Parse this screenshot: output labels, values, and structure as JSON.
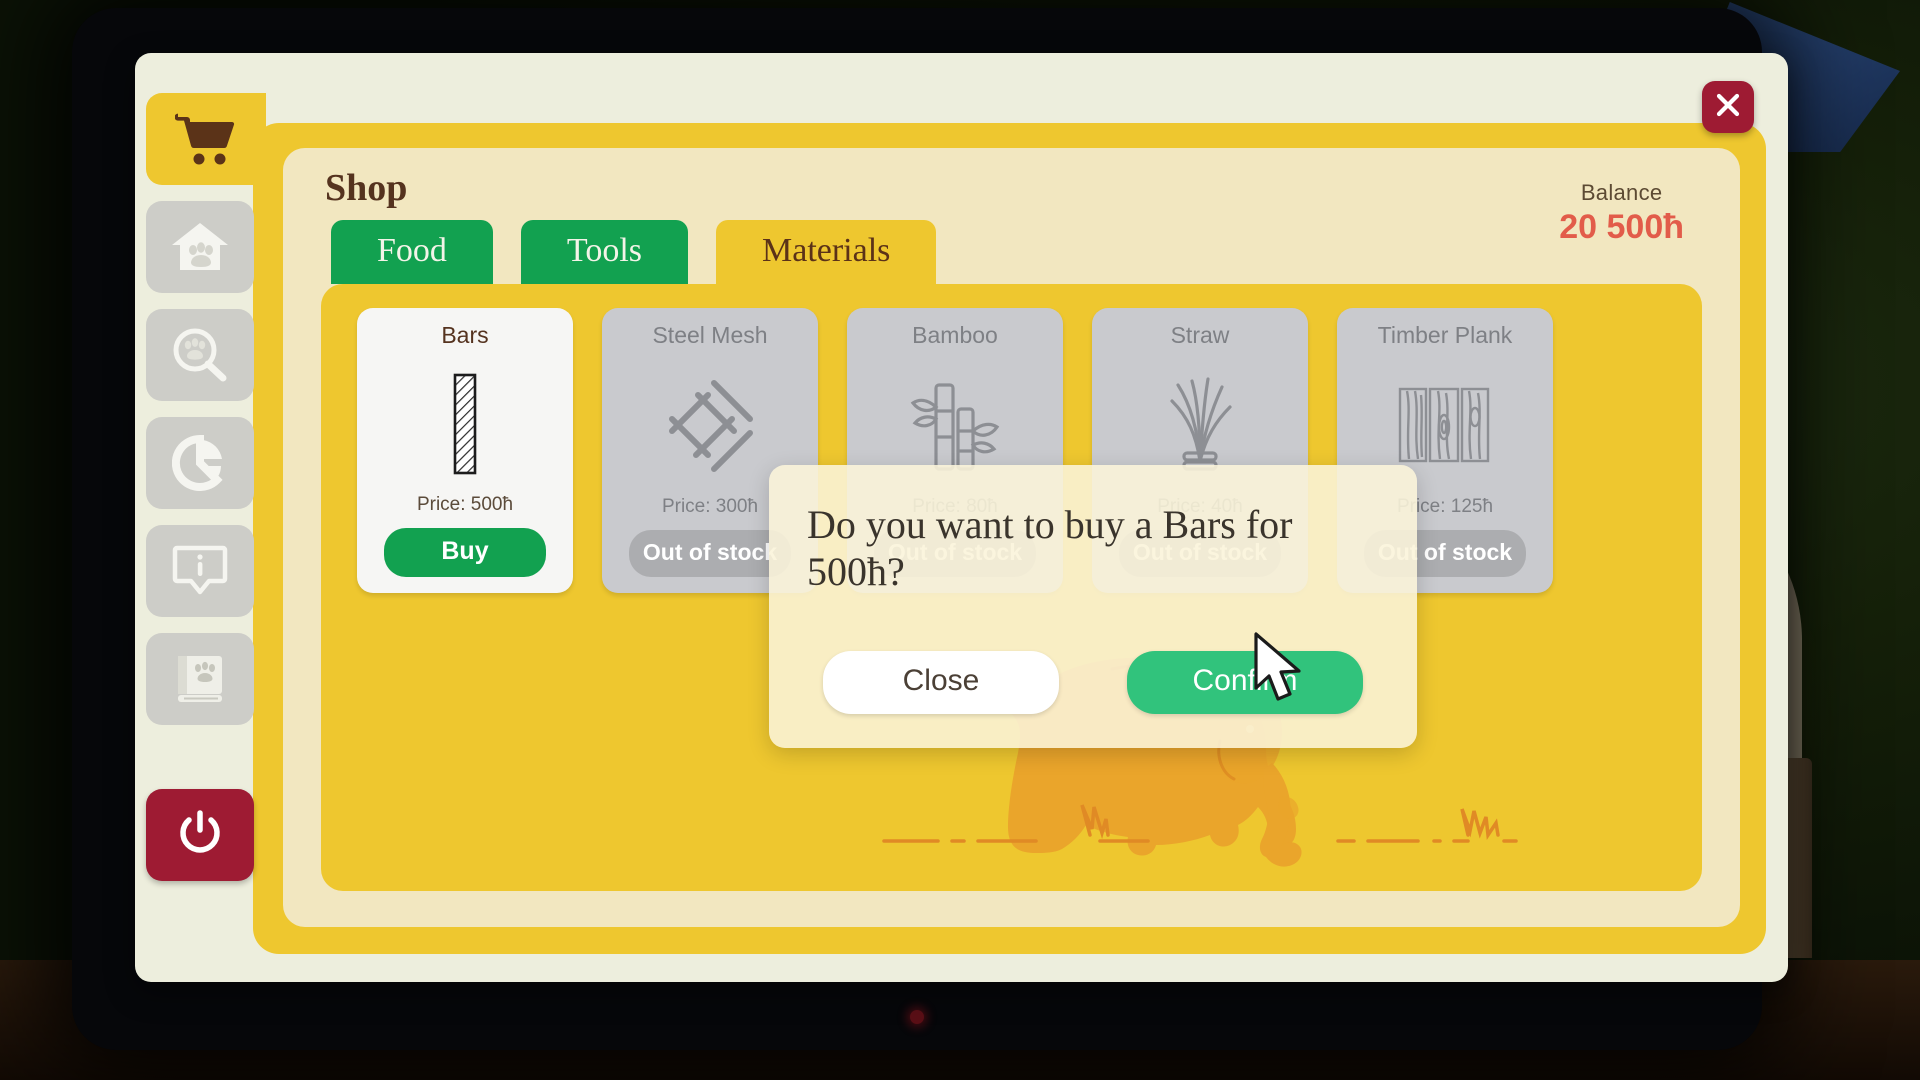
{
  "window": {
    "title": "Shop"
  },
  "sidebar": {
    "items": [
      {
        "icon": "shopping-cart-icon",
        "name": "shop",
        "active": true
      },
      {
        "icon": "pet-house-icon",
        "name": "habitats",
        "active": false
      },
      {
        "icon": "paw-search-icon",
        "name": "animal-search",
        "active": false
      },
      {
        "icon": "pie-chart-icon",
        "name": "statistics",
        "active": false
      },
      {
        "icon": "info-tooltip-icon",
        "name": "info",
        "active": false
      },
      {
        "icon": "paw-book-icon",
        "name": "encyclopedia",
        "active": false
      }
    ],
    "power": {
      "icon": "power-icon",
      "name": "quit"
    }
  },
  "header": {
    "title": "Shop",
    "balance_label": "Balance",
    "balance_value": "20 500ħ",
    "close_icon": "close-x-icon"
  },
  "tabs": [
    {
      "label": "Food",
      "active": false
    },
    {
      "label": "Tools",
      "active": false
    },
    {
      "label": "Materials",
      "active": true
    }
  ],
  "products": [
    {
      "name": "Bars",
      "icon": "metal-bar-icon",
      "price_label": "Price: 500ħ",
      "action_label": "Buy",
      "in_stock": true
    },
    {
      "name": "Steel Mesh",
      "icon": "steel-mesh-icon",
      "price_label": "Price: 300ħ",
      "action_label": "Out of stock",
      "in_stock": false
    },
    {
      "name": "Bamboo",
      "icon": "bamboo-icon",
      "price_label": "Price: 80ħ",
      "action_label": "Out of stock",
      "in_stock": false
    },
    {
      "name": "Straw",
      "icon": "straw-bundle-icon",
      "price_label": "Price: 40ħ",
      "action_label": "Out of stock",
      "in_stock": false
    },
    {
      "name": "Timber Plank",
      "icon": "timber-plank-icon",
      "price_label": "Price: 125ħ",
      "action_label": "Out of stock",
      "in_stock": false
    }
  ],
  "modal": {
    "message": "Do you want to buy a Bars for 500ħ?",
    "close_label": "Close",
    "confirm_label": "Confirm"
  },
  "decoration": {
    "name": "elephant-silhouette"
  },
  "colors": {
    "panel_yellow": "#eec72f",
    "panel_cream": "#f2e7c0",
    "window_cream": "#edeedd",
    "tab_green": "#12a150",
    "confirm_green": "#31c37c",
    "accent_red": "#9e1b33",
    "balance_red": "#e25c4a",
    "text_brown": "#55331f",
    "disabled_gray": "#acadb0",
    "card_gray": "#c9cace"
  }
}
